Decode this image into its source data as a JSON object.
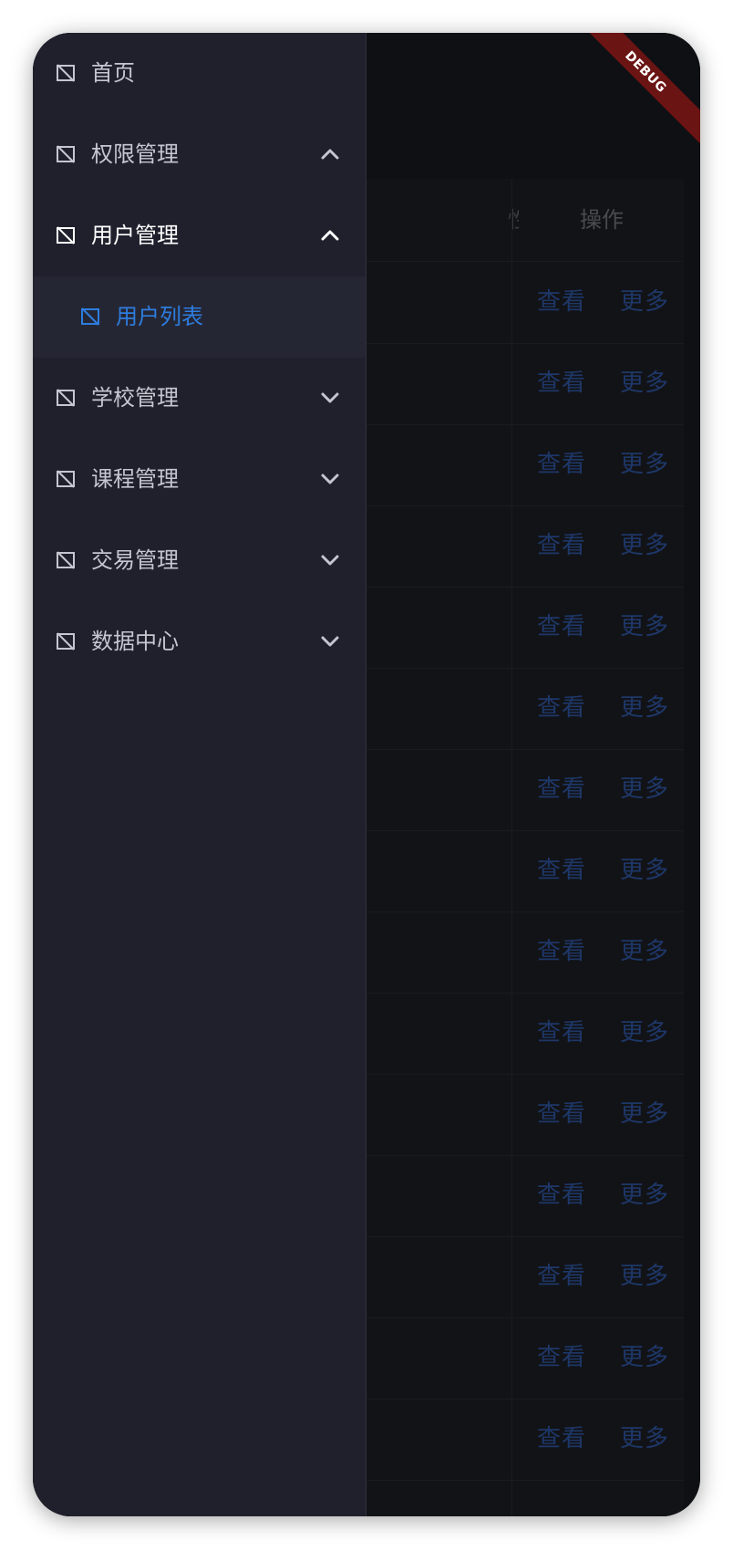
{
  "debug_banner": "DEBUG",
  "table": {
    "header_partial": "性",
    "header_ops": "操作",
    "row_actions": {
      "view": "查看",
      "more": "更多"
    },
    "row_count": 15
  },
  "drawer": {
    "items": [
      {
        "label": "首页",
        "icon": "image-off-icon",
        "chevron": ""
      },
      {
        "label": "权限管理",
        "icon": "image-off-icon",
        "chevron": "up"
      },
      {
        "label": "用户管理",
        "icon": "image-off-icon",
        "chevron": "up"
      },
      {
        "label": "用户列表",
        "icon": "image-off-icon",
        "chevron": ""
      },
      {
        "label": "学校管理",
        "icon": "image-off-icon",
        "chevron": "down"
      },
      {
        "label": "课程管理",
        "icon": "image-off-icon",
        "chevron": "down"
      },
      {
        "label": "交易管理",
        "icon": "image-off-icon",
        "chevron": "down"
      },
      {
        "label": "数据中心",
        "icon": "image-off-icon",
        "chevron": "down"
      }
    ]
  },
  "colors": {
    "drawer_bg": "#20202d",
    "active_text": "#2d7de0",
    "link_text": "#1e3768",
    "debug_bg": "#6b1414"
  }
}
